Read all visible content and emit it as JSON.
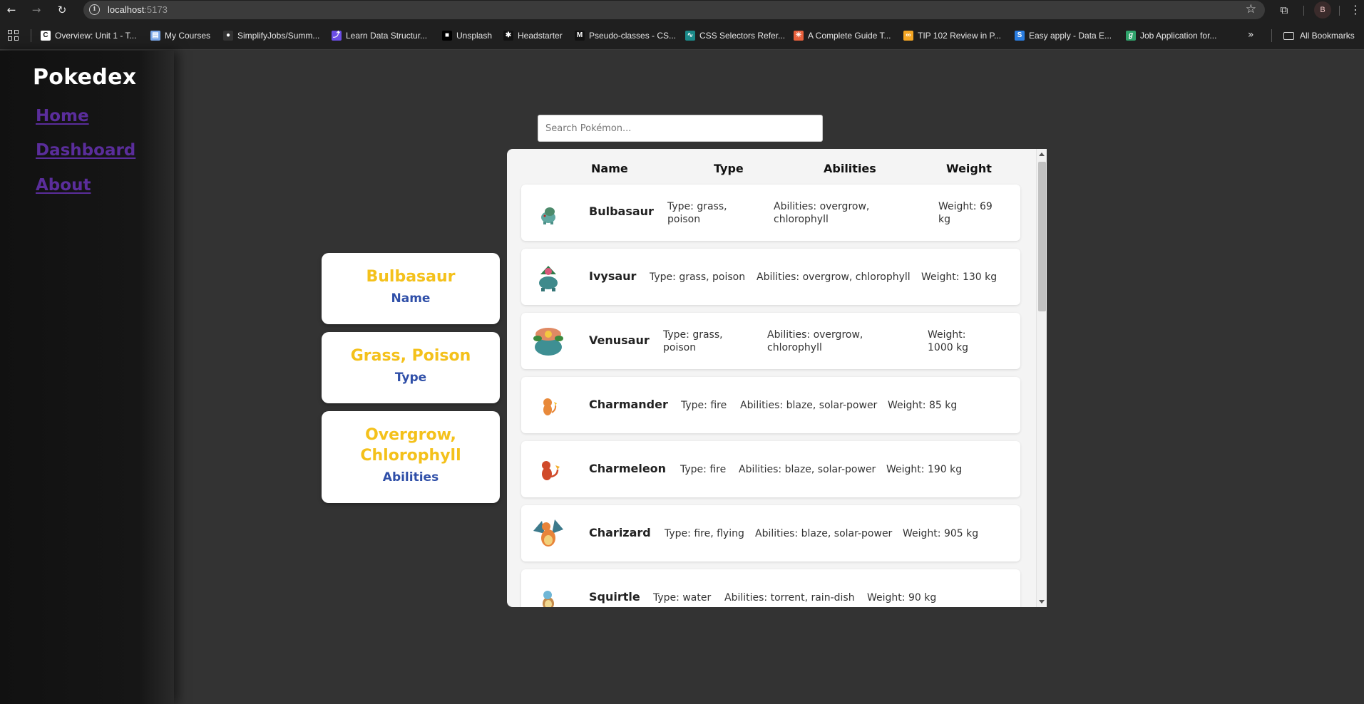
{
  "browser": {
    "url_host": "localhost",
    "url_port": ":5173",
    "profile_initial": "B",
    "bookmarks": [
      {
        "label": "Overview: Unit 1 - T...",
        "icon": "canvas-icon",
        "color": "#ffffff"
      },
      {
        "label": "My Courses",
        "icon": "courses-icon",
        "color": "#7aa7e8"
      },
      {
        "label": "SimplifyJobs/Summ...",
        "icon": "github-icon",
        "color": "#333333"
      },
      {
        "label": "Learn Data Structur...",
        "icon": "dsa-icon",
        "color": "#6b4de6"
      },
      {
        "label": "Unsplash",
        "icon": "unsplash-icon",
        "color": "#000000"
      },
      {
        "label": "Headstarter",
        "icon": "headstarter-icon",
        "color": "#111111"
      },
      {
        "label": "Pseudo-classes - CS...",
        "icon": "mdn-icon",
        "color": "#111111"
      },
      {
        "label": "CSS Selectors Refer...",
        "icon": "w3-icon",
        "color": "#1b8a8a"
      },
      {
        "label": "A Complete Guide T...",
        "icon": "css-tricks-icon",
        "color": "#e8603c"
      },
      {
        "label": "TIP 102 Review in P...",
        "icon": "codepath-icon",
        "color": "#f5a623"
      },
      {
        "label": "Easy apply - Data E...",
        "icon": "simplify-icon",
        "color": "#2a7de1"
      },
      {
        "label": "Job Application for...",
        "icon": "greenhouse-icon",
        "color": "#2fa36b"
      }
    ],
    "all_bookmarks": "All Bookmarks"
  },
  "sidebar": {
    "brand": "Pokedex",
    "links": [
      "Home",
      "Dashboard",
      "About"
    ]
  },
  "search": {
    "placeholder": "Search Pokémon...",
    "value": ""
  },
  "summary_cards": [
    {
      "value": "Bulbasaur",
      "label": "Name"
    },
    {
      "value": "Grass, Poison",
      "label": "Type"
    },
    {
      "value": "Overgrow, Chlorophyll",
      "label": "Abilities"
    }
  ],
  "table": {
    "headers": [
      "Name",
      "Type",
      "Abilities",
      "Weight"
    ],
    "rows": [
      {
        "name": "Bulbasaur",
        "type": "Type: grass, poison",
        "abilities": "Abilities: overgrow, chlorophyll",
        "weight": "Weight: 69 kg",
        "sprite": "bulbasaur-sprite-icon"
      },
      {
        "name": "Ivysaur",
        "type": "Type: grass, poison",
        "abilities": "Abilities: overgrow, chlorophyll",
        "weight": "Weight: 130 kg",
        "sprite": "ivysaur-sprite-icon"
      },
      {
        "name": "Venusaur",
        "type": "Type: grass, poison",
        "abilities": "Abilities: overgrow, chlorophyll",
        "weight": "Weight: 1000 kg",
        "sprite": "venusaur-sprite-icon"
      },
      {
        "name": "Charmander",
        "type": "Type: fire",
        "abilities": "Abilities: blaze, solar-power",
        "weight": "Weight: 85 kg",
        "sprite": "charmander-sprite-icon"
      },
      {
        "name": "Charmeleon",
        "type": "Type: fire",
        "abilities": "Abilities: blaze, solar-power",
        "weight": "Weight: 190 kg",
        "sprite": "charmeleon-sprite-icon"
      },
      {
        "name": "Charizard",
        "type": "Type: fire, flying",
        "abilities": "Abilities: blaze, solar-power",
        "weight": "Weight: 905 kg",
        "sprite": "charizard-sprite-icon"
      },
      {
        "name": "Squirtle",
        "type": "Type: water",
        "abilities": "Abilities: torrent, rain-dish",
        "weight": "Weight: 90 kg",
        "sprite": "squirtle-sprite-icon"
      }
    ]
  },
  "colors": {
    "accent_yellow": "#f4c11b",
    "accent_blue": "#2f4fa8",
    "link_purple": "#5a2d9b",
    "page_bg": "#333333"
  }
}
